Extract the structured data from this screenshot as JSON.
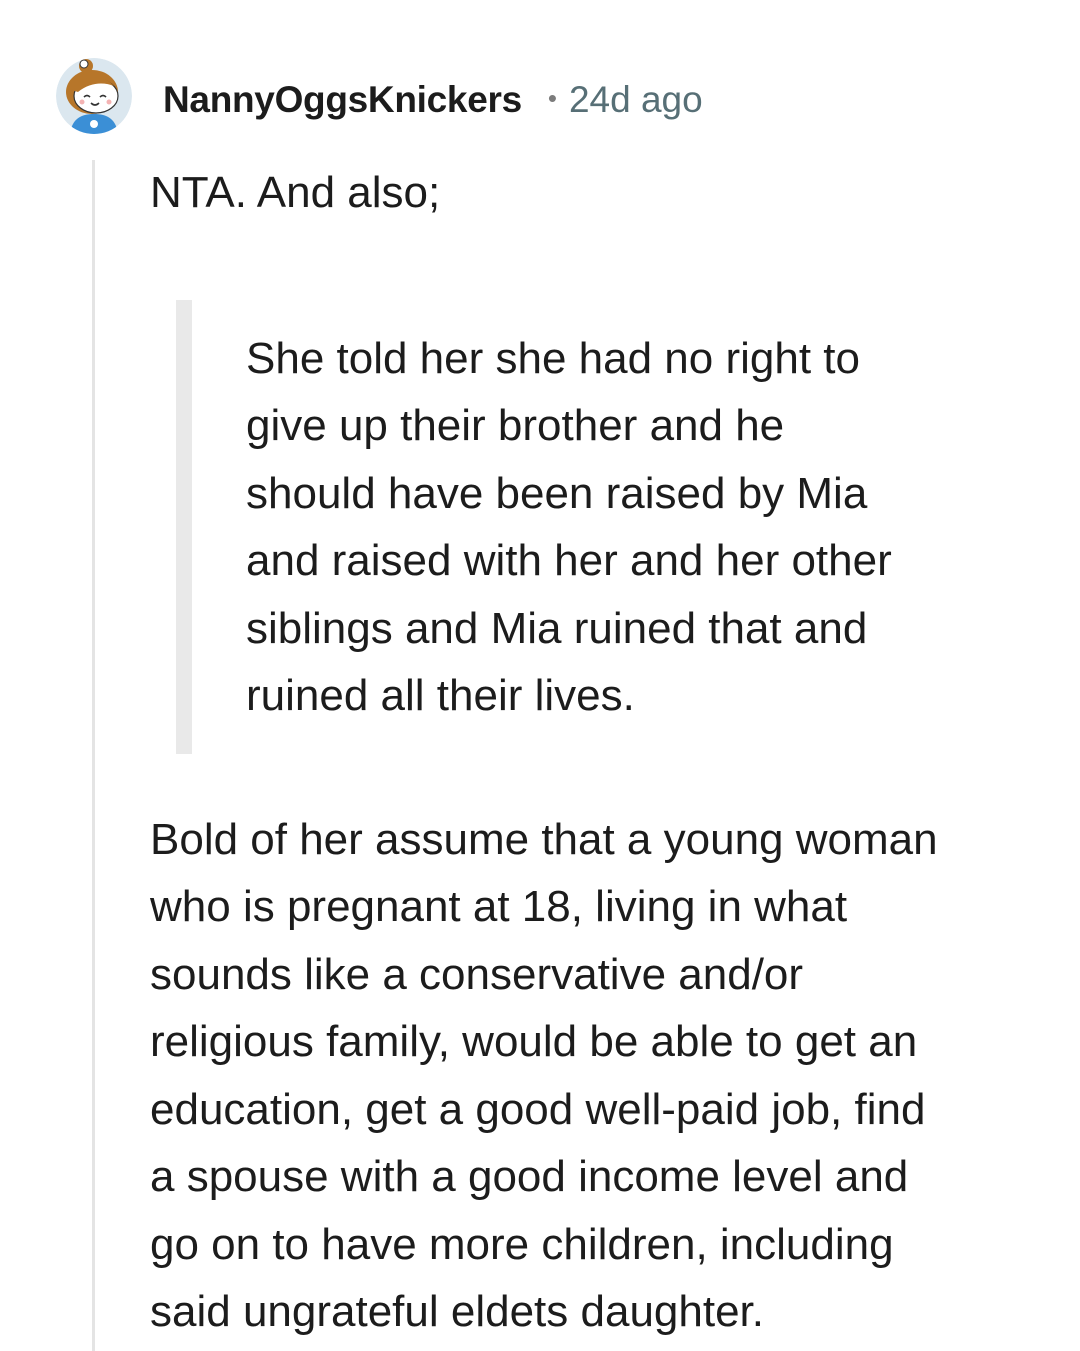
{
  "comment": {
    "author": "NannyOggsKnickers",
    "separator": "•",
    "age": "24d ago",
    "avatar_icon": "snoo-avatar-girl-with-bun",
    "intro": "NTA. And also;",
    "quote_lines": [
      "She told her she had no right to",
      "give up their brother and he",
      "should have been raised by Mia",
      "and raised with her and her other",
      "siblings and Mia ruined that and",
      "ruined all their lives."
    ],
    "body_lines": [
      "Bold of her assume that a young woman",
      "who is pregnant at 18, living in what",
      "sounds like a conservative and/or",
      "religious family, would be able to get an",
      "education, get a good well-paid job, find",
      "a spouse with a good income level and",
      "go on to have more children, including",
      "said ungrateful eldets daughter."
    ]
  },
  "colors": {
    "text": "#1c1c1c",
    "meta": "#576f76",
    "thread_line": "#e4e4e4",
    "quote_bar": "#e9e9e9",
    "avatar_bg": "#dbe7ef"
  }
}
